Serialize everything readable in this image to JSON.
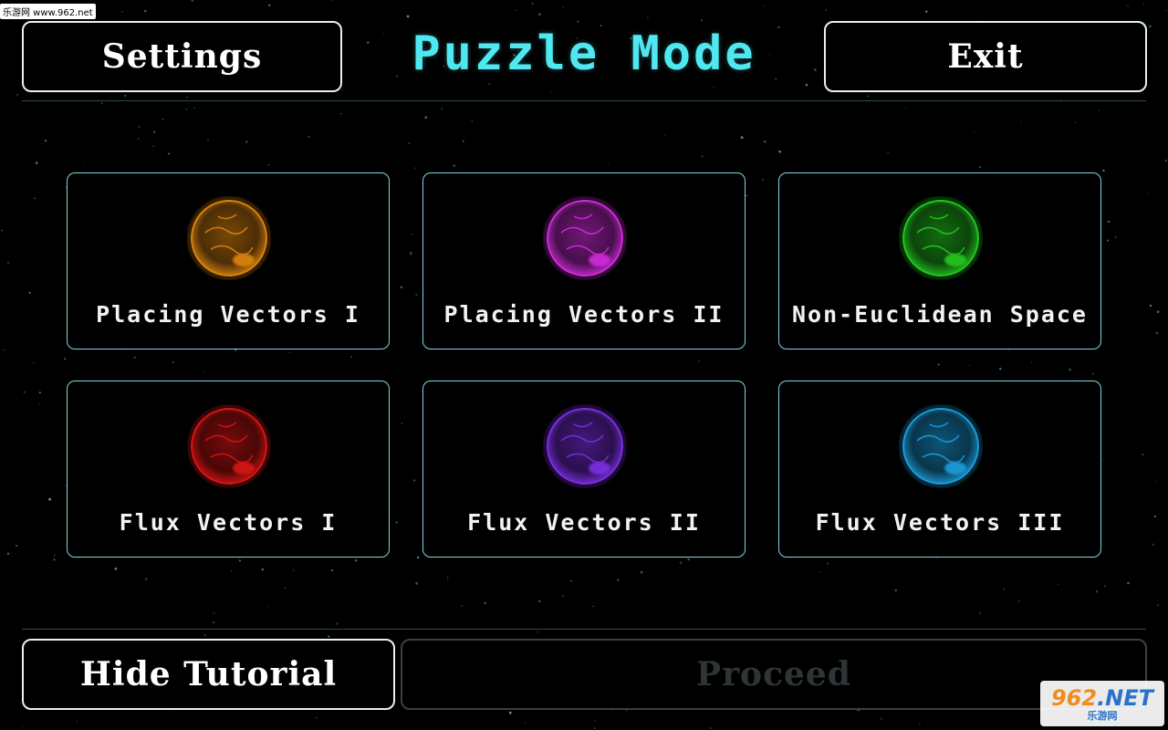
{
  "header": {
    "settings_label": "Settings",
    "title": "Puzzle Mode",
    "exit_label": "Exit"
  },
  "levels": [
    {
      "label": "Placing Vectors I",
      "planet_color": "#d9820f",
      "planet_icon": "orange-planet-icon"
    },
    {
      "label": "Placing Vectors II",
      "planet_color": "#cc2bd6",
      "planet_icon": "magenta-planet-icon"
    },
    {
      "label": "Non-Euclidean Space",
      "planet_color": "#22c41e",
      "planet_icon": "green-planet-icon"
    },
    {
      "label": "Flux Vectors I",
      "planet_color": "#d41414",
      "planet_icon": "red-planet-icon"
    },
    {
      "label": "Flux Vectors II",
      "planet_color": "#7a2ee0",
      "planet_icon": "purple-planet-icon"
    },
    {
      "label": "Flux Vectors III",
      "planet_color": "#1a9ad8",
      "planet_icon": "blue-planet-icon"
    }
  ],
  "footer": {
    "hide_tutorial_label": "Hide Tutorial",
    "proceed_label": "Proceed"
  },
  "watermarks": {
    "top_left": "乐游网 www.962.net",
    "bottom_right_main": "962",
    "bottom_right_suffix": ".NET",
    "bottom_right_sub": "乐游网"
  },
  "colors": {
    "title": "#4fe8f0",
    "card_border": "#7fd8de",
    "button_border": "#e8f0f2",
    "disabled_text": "#2f3436",
    "background": "#000000"
  }
}
